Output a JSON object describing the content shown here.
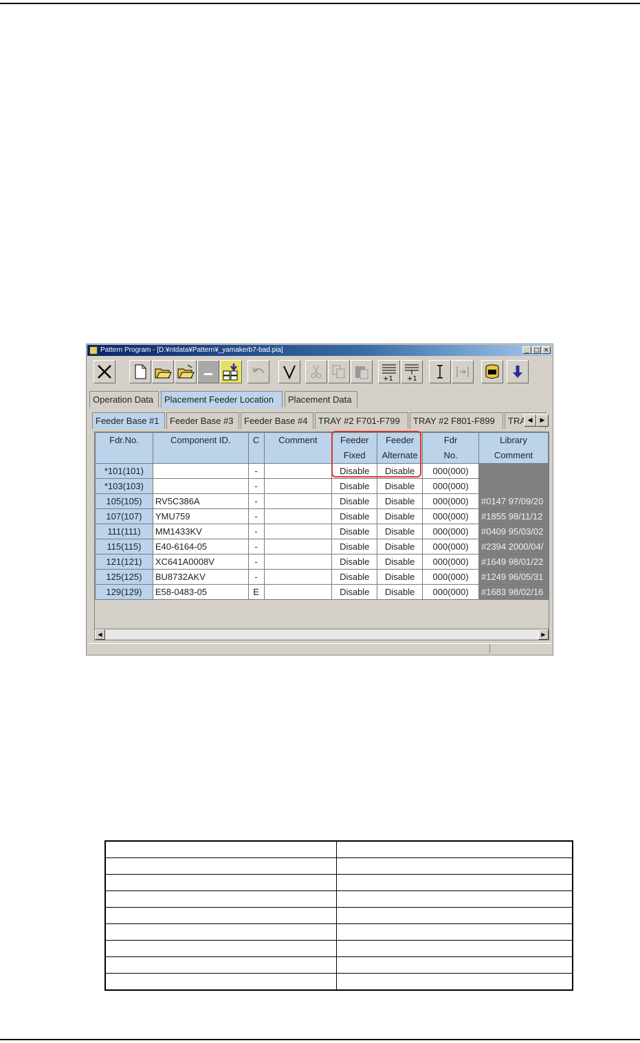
{
  "window": {
    "title": "Pattern Program - [D:¥ntdata¥Pattern¥_yamakerb7-bad.pia]",
    "controls": [
      "_",
      "□",
      "×"
    ]
  },
  "tabs_main": [
    {
      "label": "Operation Data",
      "active": false
    },
    {
      "label": "Placement Feeder Location",
      "active": true
    },
    {
      "label": "Placement Data",
      "active": false
    }
  ],
  "tabs_feeder": [
    {
      "label": "Feeder Base #1",
      "active": true
    },
    {
      "label": "Feeder Base #3",
      "active": false
    },
    {
      "label": "Feeder Base #4",
      "active": false
    },
    {
      "label": "TRAY #2 F701-F799",
      "active": false
    },
    {
      "label": "TRAY #2 F801-F899",
      "active": false
    },
    {
      "label": "TRA",
      "active": false
    }
  ],
  "grid": {
    "headers": [
      {
        "line1": "Fdr.No.",
        "line2": ""
      },
      {
        "line1": "Component ID.",
        "line2": ""
      },
      {
        "line1": "C",
        "line2": ""
      },
      {
        "line1": "Comment",
        "line2": ""
      },
      {
        "line1": "Feeder",
        "line2": "Fixed"
      },
      {
        "line1": "Feeder",
        "line2": "Alternate"
      },
      {
        "line1": "Fdr",
        "line2": "No."
      },
      {
        "line1": "Library",
        "line2": "Comment"
      }
    ],
    "rows": [
      {
        "fdr": "*101(101)",
        "comp": "",
        "c": "-",
        "comment": "",
        "fixed": "Disable",
        "alt": "Disable",
        "fdrno": "000(000)",
        "lib": ""
      },
      {
        "fdr": "*103(103)",
        "comp": "",
        "c": "-",
        "comment": "",
        "fixed": "Disable",
        "alt": "Disable",
        "fdrno": "000(000)",
        "lib": ""
      },
      {
        "fdr": "105(105)",
        "comp": "RV5C386A",
        "c": "-",
        "comment": "",
        "fixed": "Disable",
        "alt": "Disable",
        "fdrno": "000(000)",
        "lib": "#0147 97/09/20"
      },
      {
        "fdr": "107(107)",
        "comp": "YMU759",
        "c": "-",
        "comment": "",
        "fixed": "Disable",
        "alt": "Disable",
        "fdrno": "000(000)",
        "lib": "#1855 98/11/12"
      },
      {
        "fdr": "111(111)",
        "comp": "MM1433KV",
        "c": "-",
        "comment": "",
        "fixed": "Disable",
        "alt": "Disable",
        "fdrno": "000(000)",
        "lib": "#0409 95/03/02"
      },
      {
        "fdr": "115(115)",
        "comp": "E40-6164-05",
        "c": "-",
        "comment": "",
        "fixed": "Disable",
        "alt": "Disable",
        "fdrno": "000(000)",
        "lib": "#2394 2000/04/"
      },
      {
        "fdr": "121(121)",
        "comp": "XC641A0008V",
        "c": "-",
        "comment": "",
        "fixed": "Disable",
        "alt": "Disable",
        "fdrno": "000(000)",
        "lib": "#1649 98/01/22"
      },
      {
        "fdr": "125(125)",
        "comp": "BU8732AKV",
        "c": "-",
        "comment": "",
        "fixed": "Disable",
        "alt": "Disable",
        "fdrno": "000(000)",
        "lib": "#1249 96/05/31"
      },
      {
        "fdr": "129(129)",
        "comp": "E58-0483-05",
        "c": "E",
        "comment": "",
        "fixed": "Disable",
        "alt": "Disable",
        "fdrno": "000(000)",
        "lib": "#1683 98/02/16"
      }
    ]
  },
  "toolbar_icons": [
    "close-icon",
    "new-file-icon",
    "open-folder-icon",
    "open-folder-2-icon",
    "minus-icon",
    "download-grid-icon",
    "undo-icon",
    "check-icon",
    "cut-icon",
    "copy-icon",
    "paste-icon",
    "increment-icon",
    "increment-2-icon",
    "cursor-icon",
    "skip-icon",
    "database-icon",
    "down-arrow-icon"
  ],
  "highlight_color": "#d43b2b",
  "header_color": "#bcd3ec"
}
